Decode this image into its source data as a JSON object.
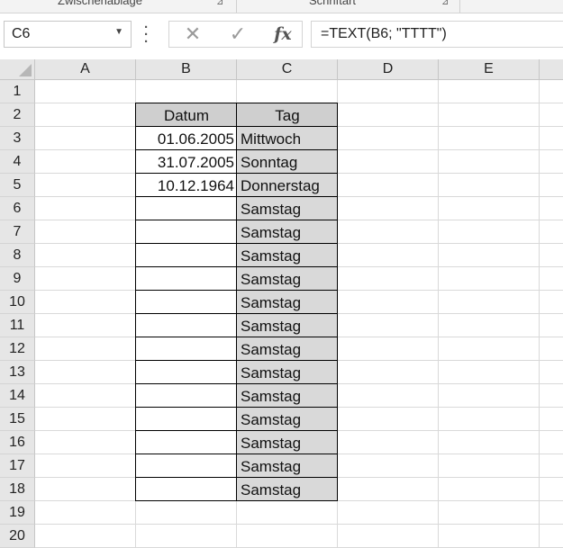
{
  "ribbon": {
    "groups": [
      "Zwischenablage",
      "Schriftart"
    ]
  },
  "name_box": {
    "value": "C6",
    "dropdown_icon": "chevron-down-icon"
  },
  "formula_bar": {
    "cancel_icon": "cancel-x-icon",
    "enter_icon": "checkmark-icon",
    "fx_label": "fx",
    "formula": "=TEXT(B6; \"TTTT\")"
  },
  "columns": [
    "A",
    "B",
    "C",
    "D",
    "E"
  ],
  "rows": [
    "1",
    "2",
    "3",
    "4",
    "5",
    "6",
    "7",
    "8",
    "9",
    "10",
    "11",
    "12",
    "13",
    "14",
    "15",
    "16",
    "17",
    "18",
    "19",
    "20"
  ],
  "table": {
    "headers": [
      "Datum",
      "Tag"
    ],
    "rows": [
      [
        "01.06.2005",
        "Mittwoch"
      ],
      [
        "31.07.2005",
        "Sonntag"
      ],
      [
        "10.12.1964",
        "Donnerstag"
      ],
      [
        "",
        "Samstag"
      ],
      [
        "",
        "Samstag"
      ],
      [
        "",
        "Samstag"
      ],
      [
        "",
        "Samstag"
      ],
      [
        "",
        "Samstag"
      ],
      [
        "",
        "Samstag"
      ],
      [
        "",
        "Samstag"
      ],
      [
        "",
        "Samstag"
      ],
      [
        "",
        "Samstag"
      ],
      [
        "",
        "Samstag"
      ],
      [
        "",
        "Samstag"
      ],
      [
        "",
        "Samstag"
      ],
      [
        "",
        "Samstag"
      ]
    ]
  }
}
